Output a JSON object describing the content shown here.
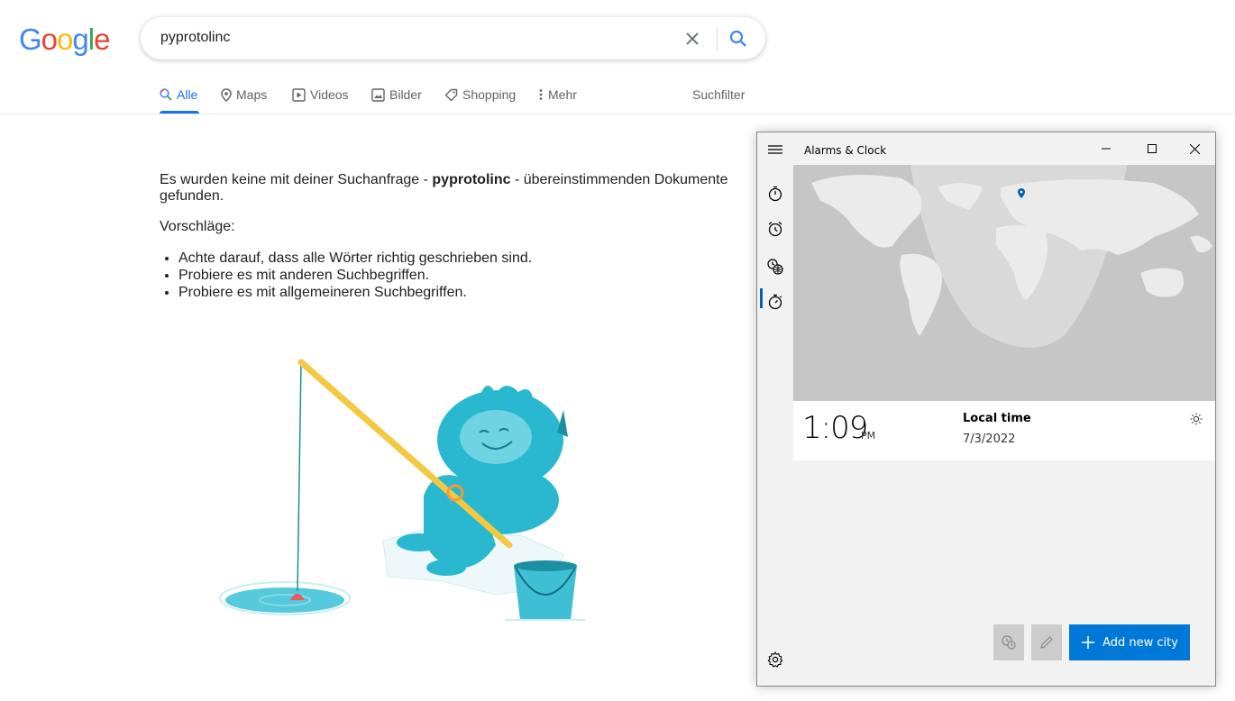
{
  "google": {
    "logo_text": "Google",
    "logo_letters": [
      {
        "ch": "G",
        "color": "#4285f4"
      },
      {
        "ch": "o",
        "color": "#ea4335"
      },
      {
        "ch": "o",
        "color": "#fbbc05"
      },
      {
        "ch": "g",
        "color": "#4285f4"
      },
      {
        "ch": "l",
        "color": "#34a853"
      },
      {
        "ch": "e",
        "color": "#ea4335"
      }
    ],
    "search": {
      "query": "pyprotolinc"
    },
    "tabs": {
      "alle": "Alle",
      "maps": "Maps",
      "videos": "Videos",
      "bilder": "Bilder",
      "shopping": "Shopping",
      "mehr": "Mehr",
      "suchfilter": "Suchfilter"
    },
    "accent_color": "#1a73e8",
    "result": {
      "no_results_prefix": "Es wurden keine mit deiner Suchanfrage - ",
      "no_results_query": "pyprotolinc",
      "no_results_suffix": " - übereinstimmenden Dokumente gefunden.",
      "suggestions_label": "Vorschläge:",
      "suggestions": [
        "Achte darauf, dass alle Wörter richtig geschrieben sind.",
        "Probiere es mit anderen Suchbegriffen.",
        "Probiere es mit allgemeineren Suchbegriffen."
      ]
    }
  },
  "clock_app": {
    "title": "Alarms & Clock",
    "accent_color": "#0078d7",
    "local_time": {
      "time": "1:09",
      "ampm": "PM",
      "label": "Local time",
      "date": "7/3/2022"
    },
    "add_city_label": "Add new city",
    "nav_icons": [
      "timer-icon",
      "alarm-icon",
      "world-clock-icon",
      "stopwatch-icon",
      "settings-icon"
    ]
  }
}
